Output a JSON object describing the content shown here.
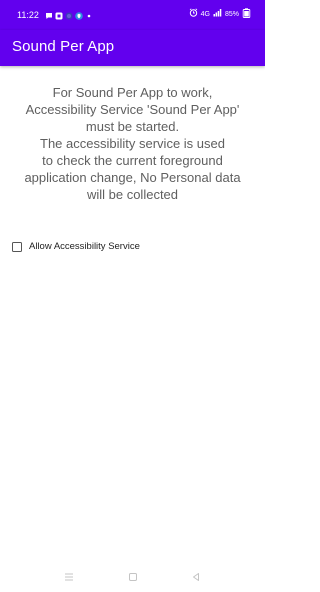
{
  "status_bar": {
    "time": "11:22",
    "battery_percent": "85%",
    "network_label": "4G",
    "left_icons": [
      "chat-icon",
      "app-icon",
      "globe-icon",
      "shield-icon",
      "dot-icon"
    ],
    "right_icons": [
      "alarm-icon",
      "signal-icon",
      "battery-icon"
    ]
  },
  "app_bar": {
    "title": "Sound Per App",
    "color": "#6200ee"
  },
  "message": {
    "lines": [
      "For Sound Per App to work,",
      "Accessibility Service 'Sound Per App'",
      "must be started.",
      "The accessibility service is used",
      "to check the current foreground",
      "application change, No Personal data",
      "will be collected"
    ]
  },
  "accessibility_option": {
    "label": "Allow Accessibility Service",
    "checked": false
  },
  "nav_bar": {
    "buttons": [
      "menu-icon",
      "home-icon",
      "back-icon"
    ]
  }
}
